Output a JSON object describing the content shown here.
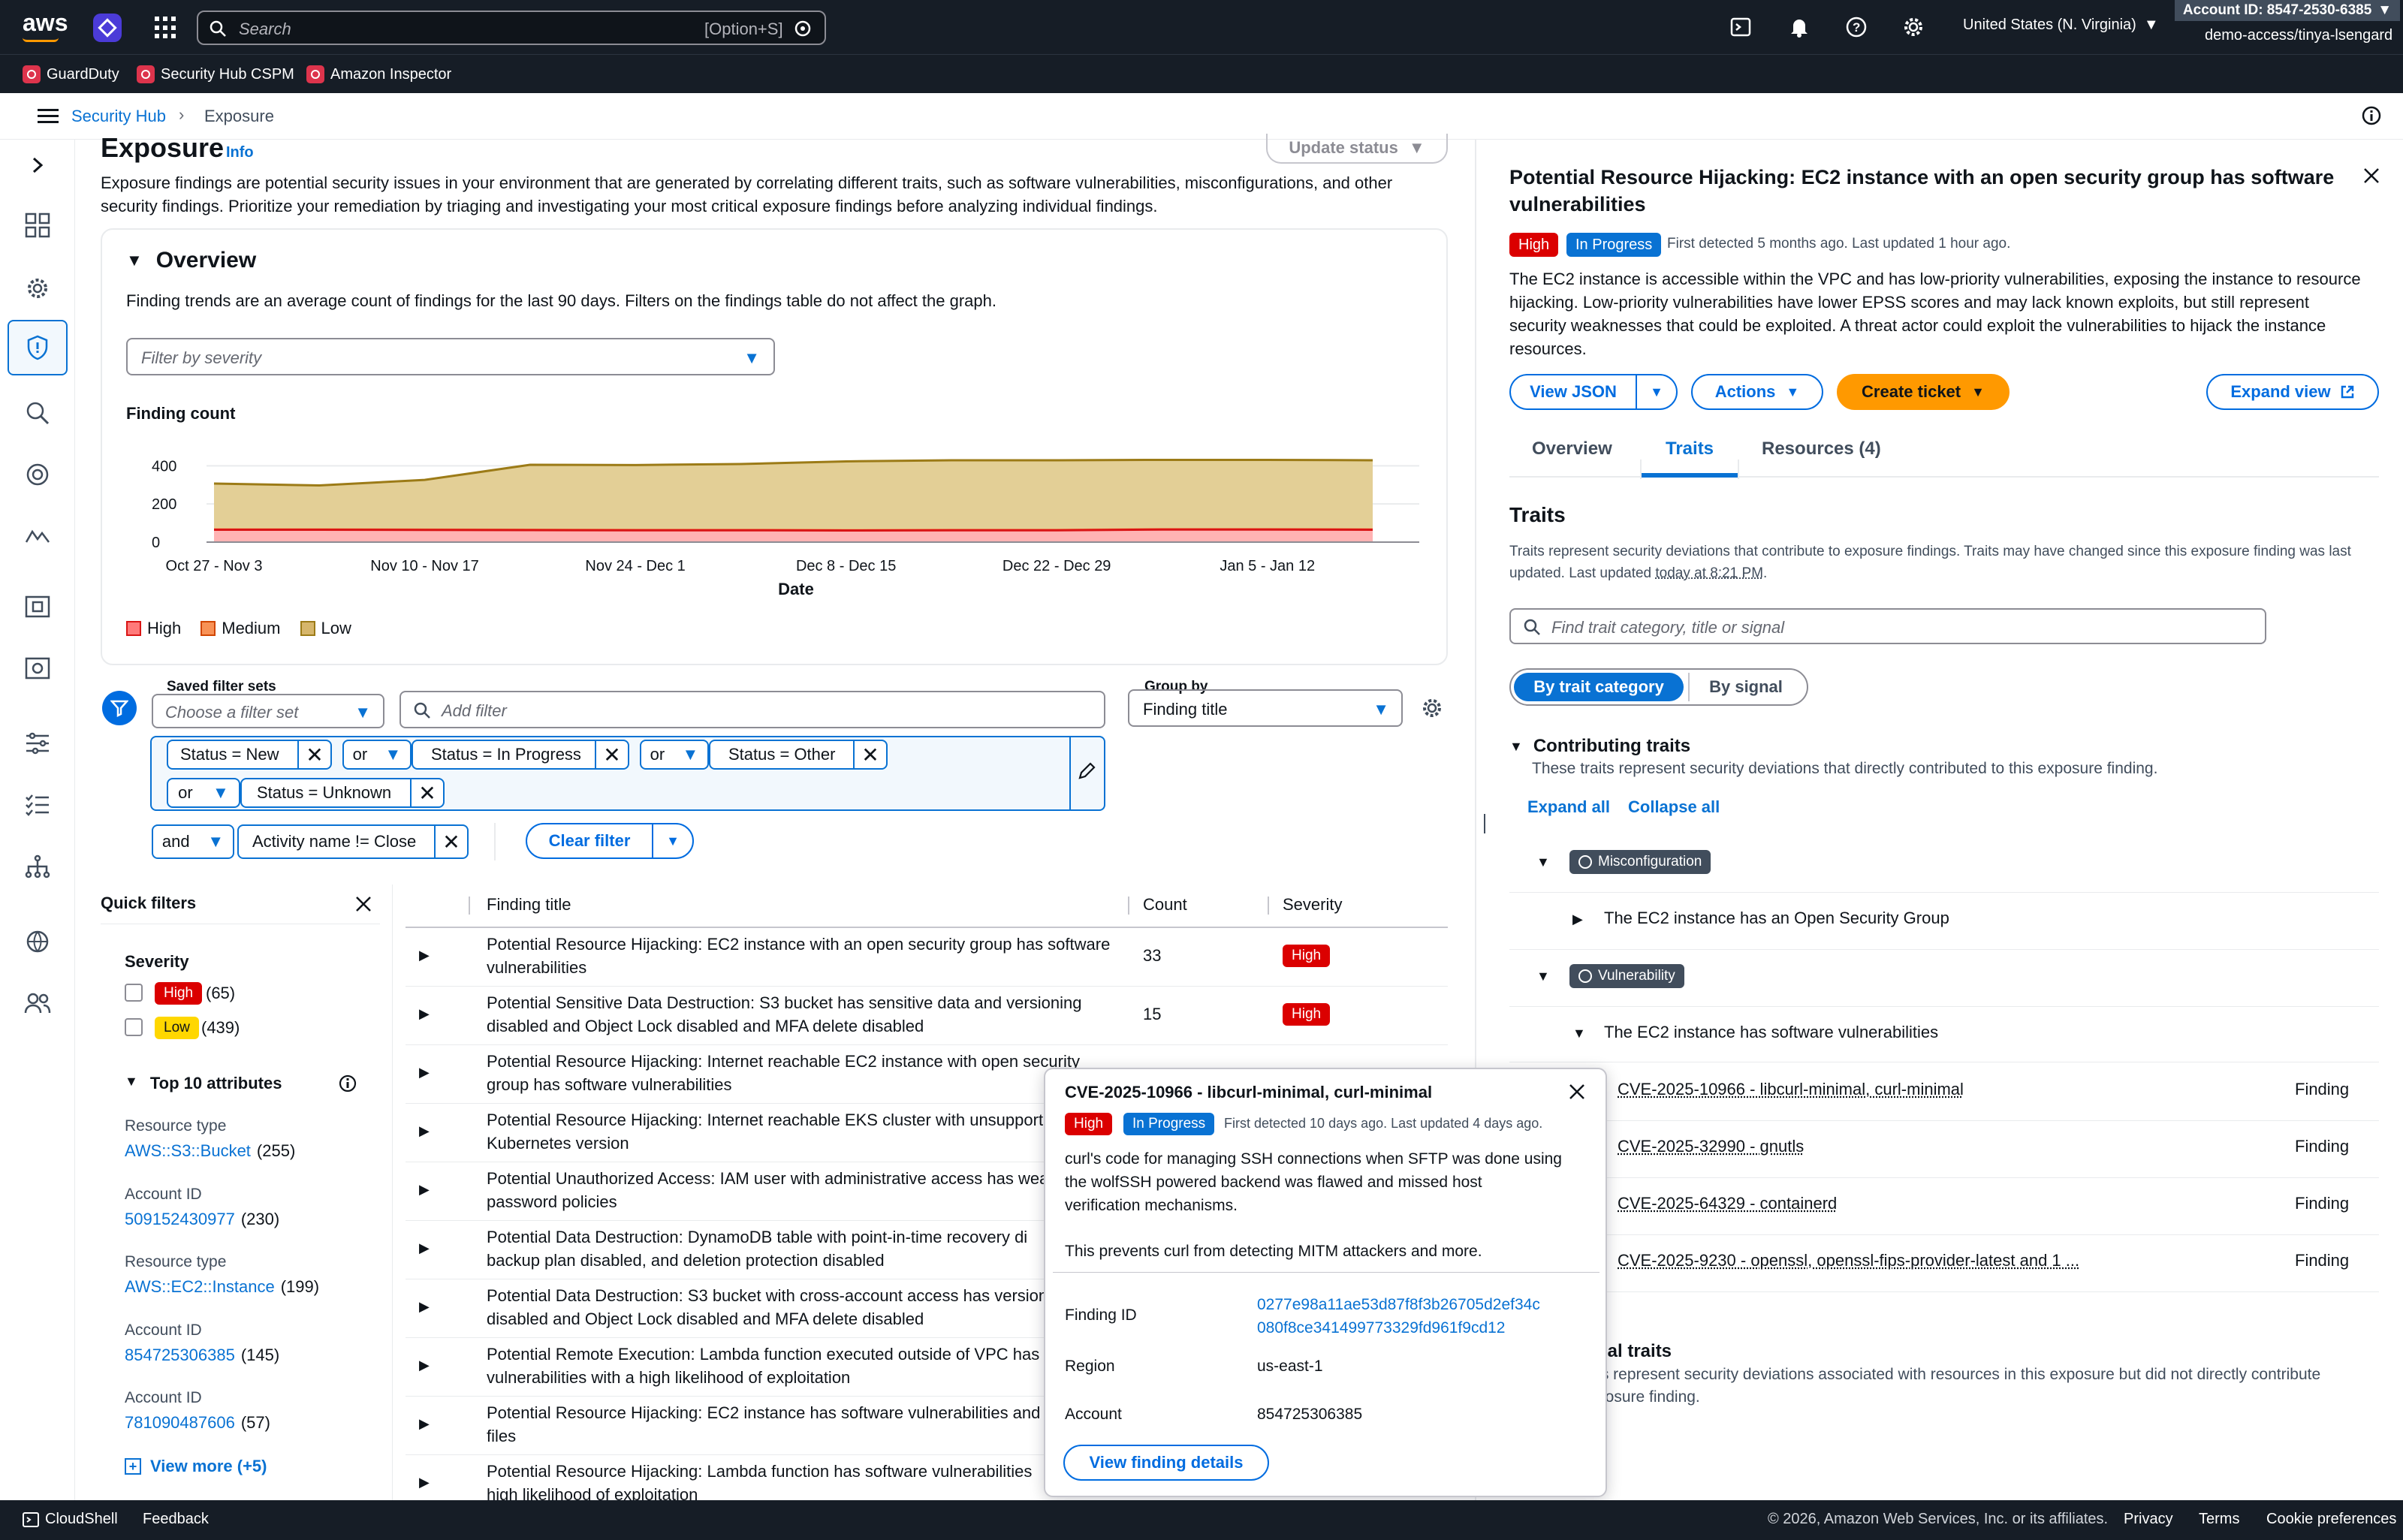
{
  "topnav": {
    "logo": "aws",
    "search_placeholder": "Search",
    "search_shortcut": "[Option+S]",
    "region": "United States (N. Virginia)",
    "account_id": "Account ID: 8547-2530-6385",
    "user": "demo-access/tinya-lsengard"
  },
  "favorites": [
    {
      "label": "GuardDuty"
    },
    {
      "label": "Security Hub CSPM"
    },
    {
      "label": "Amazon Inspector"
    }
  ],
  "breadcrumb": {
    "root": "Security Hub",
    "current": "Exposure"
  },
  "page": {
    "title": "Exposure",
    "info": "Info",
    "update_status": "Update status",
    "description": "Exposure findings are potential security issues in your environment that are generated by correlating different traits, such as software vulnerabilities, misconfigurations, and other security findings. Prioritize your remediation by triaging and investigating your most critical exposure findings before analyzing individual findings."
  },
  "overview": {
    "title": "Overview",
    "note": "Finding trends are an average count of findings for the last 90 days. Filters on the findings table do not affect the graph.",
    "filter_placeholder": "Filter by severity",
    "chart_title": "Finding count"
  },
  "chart_data": {
    "type": "area",
    "title": "Finding count",
    "xlabel": "Date",
    "ylabel": "",
    "x": [
      "Oct 27 - Nov 3",
      "Nov 3 - Nov 10",
      "Nov 10 - Nov 17",
      "Nov 17 - Nov 24",
      "Nov 24 - Dec 1",
      "Dec 1 - Dec 8",
      "Dec 8 - Dec 15",
      "Dec 15 - Dec 22",
      "Dec 22 - Dec 29",
      "Dec 29 - Jan 5",
      "Jan 5 - Jan 12",
      "Jan 12 - Jan 19"
    ],
    "xticks": [
      "Oct 27 - Nov 3",
      "Nov 10 - Nov 17",
      "Nov 24 - Dec 1",
      "Dec 8 - Dec 15",
      "Dec 22 - Dec 29",
      "Jan 5 - Jan 12"
    ],
    "yticks": [
      0,
      200,
      400
    ],
    "ylim": [
      0,
      480
    ],
    "stacked": true,
    "series": [
      {
        "name": "High",
        "color": "#d91515",
        "values": [
          65,
          65,
          64,
          63,
          62,
          62,
          61,
          62,
          62,
          66,
          66,
          65
        ]
      },
      {
        "name": "Medium",
        "color": "#f89256",
        "values": [
          2,
          2,
          2,
          2,
          2,
          2,
          2,
          2,
          2,
          2,
          2,
          2
        ]
      },
      {
        "name": "Low",
        "color": "#d6b66b",
        "values": [
          240,
          230,
          260,
          340,
          340,
          345,
          360,
          365,
          365,
          363,
          363,
          362
        ]
      }
    ]
  },
  "filters": {
    "saved_label": "Saved filter sets",
    "saved_placeholder": "Choose a filter set",
    "add_placeholder": "Add filter",
    "group_label": "Group by",
    "group_value": "Finding title",
    "tokens": [
      "Status = New",
      "Status = In Progress",
      "Status = Other",
      "Status = Unknown",
      "Activity name != Close"
    ],
    "op_or": "or",
    "op_and": "and",
    "clear": "Clear filter"
  },
  "quick_filters": {
    "title": "Quick filters",
    "severity_label": "Severity",
    "high": "High",
    "high_count": "(65)",
    "low": "Low",
    "low_count": "(439)",
    "top_attrs": "Top 10 attributes",
    "attrs": [
      {
        "label": "Resource type",
        "value": "AWS::S3::Bucket",
        "count": "(255)"
      },
      {
        "label": "Account ID",
        "value": "509152430977",
        "count": "(230)"
      },
      {
        "label": "Resource type",
        "value": "AWS::EC2::Instance",
        "count": "(199)"
      },
      {
        "label": "Account ID",
        "value": "854725306385",
        "count": "(145)"
      },
      {
        "label": "Account ID",
        "value": "781090487606",
        "count": "(57)"
      }
    ],
    "view_more": "View more (+5)"
  },
  "table": {
    "col_title": "Finding title",
    "col_count": "Count",
    "col_severity": "Severity",
    "rows": [
      {
        "title1": "Potential Resource Hijacking: EC2 instance with an open security group has software",
        "title2": "vulnerabilities",
        "count": "33",
        "severity": "High"
      },
      {
        "title1": "Potential Sensitive Data Destruction: S3 bucket has sensitive data and versioning",
        "title2": "disabled and Object Lock disabled and MFA delete disabled",
        "count": "15",
        "severity": "High"
      },
      {
        "title1": "Potential Resource Hijacking: Internet reachable EC2 instance with open security",
        "title2": "group has software vulnerabilities",
        "count": "",
        "severity": ""
      },
      {
        "title1": "Potential Resource Hijacking: Internet reachable EKS cluster with unsupport",
        "title2": "Kubernetes version",
        "count": "",
        "severity": ""
      },
      {
        "title1": "Potential Unauthorized Access: IAM user with administrative access has wea",
        "title2": "password policies",
        "count": "",
        "severity": ""
      },
      {
        "title1": "Potential Data Destruction: DynamoDB table with point-in-time recovery di",
        "title2": "backup plan disabled, and deletion protection disabled",
        "count": "",
        "severity": ""
      },
      {
        "title1": "Potential Data Destruction: S3 bucket with cross-account access has version",
        "title2": "disabled and Object Lock disabled and MFA delete disabled",
        "count": "",
        "severity": ""
      },
      {
        "title1": "Potential Remote Execution: Lambda function executed outside of VPC has",
        "title2": "vulnerabilities with a high likelihood of exploitation",
        "count": "",
        "severity": ""
      },
      {
        "title1": "Potential Resource Hijacking: EC2 instance has software vulnerabilities and",
        "title2": "files",
        "count": "",
        "severity": ""
      },
      {
        "title1": "Potential Resource Hijacking: Lambda function has software vulnerabilities",
        "title2": "high likelihood of exploitation",
        "count": "",
        "severity": ""
      }
    ]
  },
  "panel": {
    "title1": "Potential Resource Hijacking: EC2 instance with an open security group has software",
    "title2": "vulnerabilities",
    "severity": "High",
    "status": "In Progress",
    "meta": "First detected 5 months ago. Last updated 1 hour ago.",
    "desc1": "The EC2 instance is accessible within the VPC and has low-priority vulnerabilities, exposing the instance to resource",
    "desc2": "hijacking. Low-priority vulnerabilities have lower EPSS scores and may lack known exploits, but still represent",
    "desc3": "security weaknesses that could be exploited. A threat actor could exploit the vulnerabilities to hijack the instance",
    "desc4": "resources.",
    "view_json": "View JSON",
    "actions": "Actions",
    "create_ticket": "Create ticket",
    "expand_view": "Expand view",
    "tabs": [
      "Overview",
      "Traits",
      "Resources (4)"
    ],
    "traits_title": "Traits",
    "traits_desc1": "Traits represent security deviations that contribute to exposure findings. Traits may have changed since this exposure finding was last",
    "traits_desc2": "updated. Last updated ",
    "traits_time": "today at 8:21 PM",
    "traits_desc3": ".",
    "search_placeholder": "Find trait category, title or signal",
    "seg_category": "By trait category",
    "seg_signal": "By signal",
    "contrib_title": "Contributing traits",
    "contrib_desc": "These traits represent security deviations that directly contributed to this exposure finding.",
    "expand_all": "Expand all",
    "collapse_all": "Collapse all",
    "cat_misconfig": "Misconfiguration",
    "trait_sg": "The EC2 instance has an Open Security Group",
    "cat_vuln": "Vulnerability",
    "trait_vuln": "The EC2 instance has software vulnerabilities",
    "cves": [
      {
        "name": "CVE-2025-10966 - libcurl-minimal, curl-minimal",
        "type": "Finding"
      },
      {
        "name": "CVE-2025-32990 - gnutls",
        "type": "Finding"
      },
      {
        "name": "CVE-2025-64329 - containerd",
        "type": "Finding"
      },
      {
        "name": "CVE-2025-9230 - openssl, openssl-fips-provider-latest and 1 ...",
        "type": "Finding"
      }
    ],
    "contextual_title": "ual traits",
    "contextual_desc1": "ts represent security deviations associated with resources in this exposure but did not directly contribute",
    "contextual_desc2": "posure finding."
  },
  "popover": {
    "title": "CVE-2025-10966 - libcurl-minimal, curl-minimal",
    "severity": "High",
    "status": "In Progress",
    "meta": "First detected 10 days ago. Last updated 4 days ago.",
    "desc1": "curl's code for managing SSH connections when SFTP was done using",
    "desc2": "the wolfSSH powered backend was flawed and missed host",
    "desc3": "verification mechanisms.",
    "desc4": "This prevents curl from detecting MITM attackers and more.",
    "finding_id_label": "Finding ID",
    "finding_id1": "0277e98a11ae53d87f8f3b26705d2ef34c",
    "finding_id2": "080f8ce341499773329fd961f9cd12",
    "region_label": "Region",
    "region": "us-east-1",
    "account_label": "Account",
    "account": "854725306385",
    "button": "View finding details"
  },
  "footer": {
    "cloudshell": "CloudShell",
    "feedback": "Feedback",
    "copyright": "© 2026, Amazon Web Services, Inc. or its affiliates.",
    "privacy": "Privacy",
    "terms": "Terms",
    "cookies": "Cookie preferences"
  }
}
